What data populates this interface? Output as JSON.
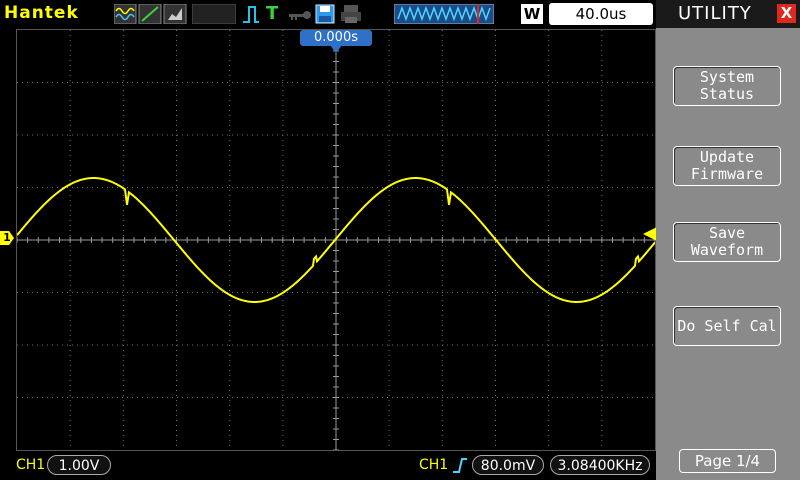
{
  "header": {
    "brand": "Hantek",
    "w_label": "W",
    "timebase": "40.0us",
    "trigger_mode_letter": "T"
  },
  "display": {
    "trigger_position": "0.000s",
    "ch1_marker": "1"
  },
  "footer": {
    "ch1_left_label": "CH1",
    "ch1_volts_div": "1.00V",
    "ch1_trig_label": "CH1",
    "trigger_level": "80.0mV",
    "frequency": "3.08400KHz"
  },
  "menu": {
    "title": "UTILITY",
    "close_glyph": "X",
    "buttons": [
      "System\nStatus",
      "Update\nFirmware",
      "Save\nWaveform",
      "Do Self Cal"
    ],
    "page": "Page 1/4"
  },
  "colors": {
    "trace": "#ffff00",
    "grid": "#6e6e6e",
    "accent_blue": "#2f70c9",
    "close_red": "#e0281e"
  }
}
